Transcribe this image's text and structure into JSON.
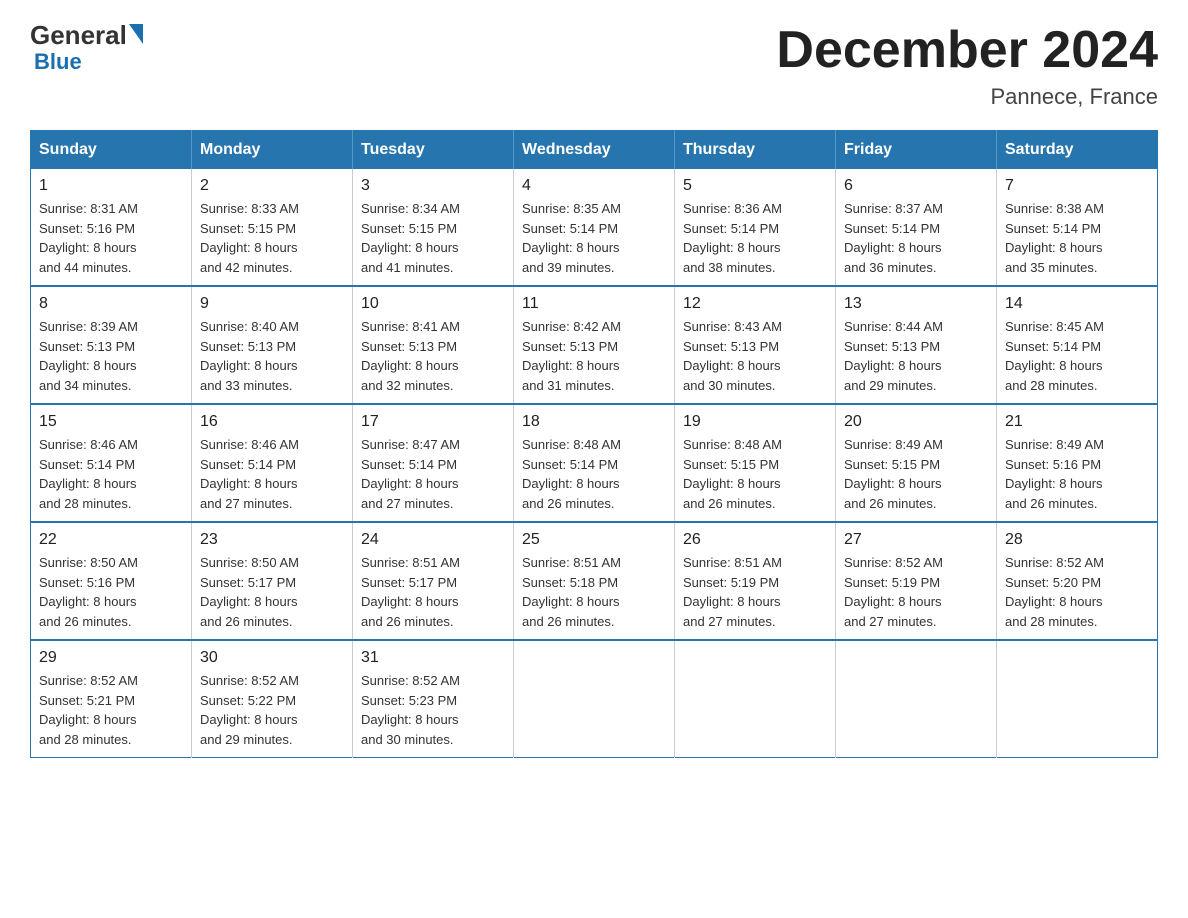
{
  "logo": {
    "general": "General",
    "blue": "Blue",
    "subtitle": "Blue"
  },
  "header": {
    "title": "December 2024",
    "location": "Pannece, France"
  },
  "days_of_week": [
    "Sunday",
    "Monday",
    "Tuesday",
    "Wednesday",
    "Thursday",
    "Friday",
    "Saturday"
  ],
  "weeks": [
    [
      {
        "day": "1",
        "sunrise": "8:31 AM",
        "sunset": "5:16 PM",
        "daylight": "8 hours and 44 minutes."
      },
      {
        "day": "2",
        "sunrise": "8:33 AM",
        "sunset": "5:15 PM",
        "daylight": "8 hours and 42 minutes."
      },
      {
        "day": "3",
        "sunrise": "8:34 AM",
        "sunset": "5:15 PM",
        "daylight": "8 hours and 41 minutes."
      },
      {
        "day": "4",
        "sunrise": "8:35 AM",
        "sunset": "5:14 PM",
        "daylight": "8 hours and 39 minutes."
      },
      {
        "day": "5",
        "sunrise": "8:36 AM",
        "sunset": "5:14 PM",
        "daylight": "8 hours and 38 minutes."
      },
      {
        "day": "6",
        "sunrise": "8:37 AM",
        "sunset": "5:14 PM",
        "daylight": "8 hours and 36 minutes."
      },
      {
        "day": "7",
        "sunrise": "8:38 AM",
        "sunset": "5:14 PM",
        "daylight": "8 hours and 35 minutes."
      }
    ],
    [
      {
        "day": "8",
        "sunrise": "8:39 AM",
        "sunset": "5:13 PM",
        "daylight": "8 hours and 34 minutes."
      },
      {
        "day": "9",
        "sunrise": "8:40 AM",
        "sunset": "5:13 PM",
        "daylight": "8 hours and 33 minutes."
      },
      {
        "day": "10",
        "sunrise": "8:41 AM",
        "sunset": "5:13 PM",
        "daylight": "8 hours and 32 minutes."
      },
      {
        "day": "11",
        "sunrise": "8:42 AM",
        "sunset": "5:13 PM",
        "daylight": "8 hours and 31 minutes."
      },
      {
        "day": "12",
        "sunrise": "8:43 AM",
        "sunset": "5:13 PM",
        "daylight": "8 hours and 30 minutes."
      },
      {
        "day": "13",
        "sunrise": "8:44 AM",
        "sunset": "5:13 PM",
        "daylight": "8 hours and 29 minutes."
      },
      {
        "day": "14",
        "sunrise": "8:45 AM",
        "sunset": "5:14 PM",
        "daylight": "8 hours and 28 minutes."
      }
    ],
    [
      {
        "day": "15",
        "sunrise": "8:46 AM",
        "sunset": "5:14 PM",
        "daylight": "8 hours and 28 minutes."
      },
      {
        "day": "16",
        "sunrise": "8:46 AM",
        "sunset": "5:14 PM",
        "daylight": "8 hours and 27 minutes."
      },
      {
        "day": "17",
        "sunrise": "8:47 AM",
        "sunset": "5:14 PM",
        "daylight": "8 hours and 27 minutes."
      },
      {
        "day": "18",
        "sunrise": "8:48 AM",
        "sunset": "5:14 PM",
        "daylight": "8 hours and 26 minutes."
      },
      {
        "day": "19",
        "sunrise": "8:48 AM",
        "sunset": "5:15 PM",
        "daylight": "8 hours and 26 minutes."
      },
      {
        "day": "20",
        "sunrise": "8:49 AM",
        "sunset": "5:15 PM",
        "daylight": "8 hours and 26 minutes."
      },
      {
        "day": "21",
        "sunrise": "8:49 AM",
        "sunset": "5:16 PM",
        "daylight": "8 hours and 26 minutes."
      }
    ],
    [
      {
        "day": "22",
        "sunrise": "8:50 AM",
        "sunset": "5:16 PM",
        "daylight": "8 hours and 26 minutes."
      },
      {
        "day": "23",
        "sunrise": "8:50 AM",
        "sunset": "5:17 PM",
        "daylight": "8 hours and 26 minutes."
      },
      {
        "day": "24",
        "sunrise": "8:51 AM",
        "sunset": "5:17 PM",
        "daylight": "8 hours and 26 minutes."
      },
      {
        "day": "25",
        "sunrise": "8:51 AM",
        "sunset": "5:18 PM",
        "daylight": "8 hours and 26 minutes."
      },
      {
        "day": "26",
        "sunrise": "8:51 AM",
        "sunset": "5:19 PM",
        "daylight": "8 hours and 27 minutes."
      },
      {
        "day": "27",
        "sunrise": "8:52 AM",
        "sunset": "5:19 PM",
        "daylight": "8 hours and 27 minutes."
      },
      {
        "day": "28",
        "sunrise": "8:52 AM",
        "sunset": "5:20 PM",
        "daylight": "8 hours and 28 minutes."
      }
    ],
    [
      {
        "day": "29",
        "sunrise": "8:52 AM",
        "sunset": "5:21 PM",
        "daylight": "8 hours and 28 minutes."
      },
      {
        "day": "30",
        "sunrise": "8:52 AM",
        "sunset": "5:22 PM",
        "daylight": "8 hours and 29 minutes."
      },
      {
        "day": "31",
        "sunrise": "8:52 AM",
        "sunset": "5:23 PM",
        "daylight": "8 hours and 30 minutes."
      },
      null,
      null,
      null,
      null
    ]
  ],
  "labels": {
    "sunrise": "Sunrise:",
    "sunset": "Sunset:",
    "daylight": "Daylight:"
  }
}
